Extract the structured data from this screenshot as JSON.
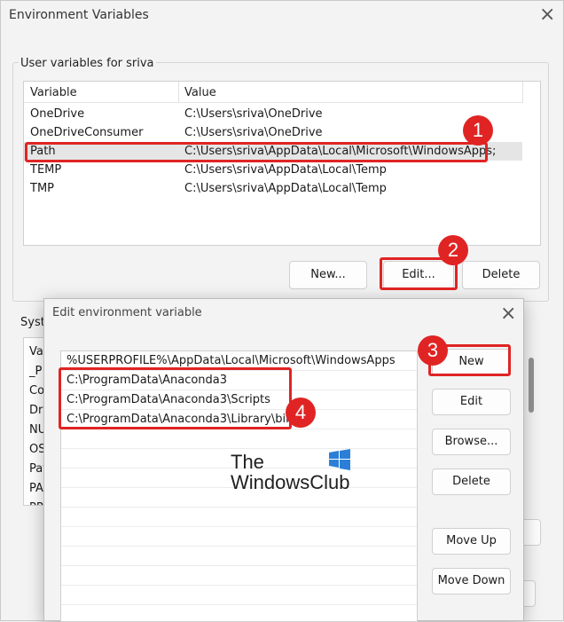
{
  "window": {
    "title": "Environment Variables",
    "close_glyph": "×",
    "user_group_label": "User variables for sriva",
    "columns": {
      "variable": "Variable",
      "value": "Value"
    },
    "user_vars": [
      {
        "name": "OneDrive",
        "value": "C:\\Users\\sriva\\OneDrive",
        "selected": false
      },
      {
        "name": "OneDriveConsumer",
        "value": "C:\\Users\\sriva\\OneDrive",
        "selected": false
      },
      {
        "name": "Path",
        "value": "C:\\Users\\sriva\\AppData\\Local\\Microsoft\\WindowsApps;",
        "selected": true
      },
      {
        "name": "TEMP",
        "value": "C:\\Users\\sriva\\AppData\\Local\\Temp",
        "selected": false
      },
      {
        "name": "TMP",
        "value": "C:\\Users\\sriva\\AppData\\Local\\Temp",
        "selected": false
      }
    ],
    "buttons": {
      "new": "New...",
      "edit": "Edit...",
      "delete": "Delete"
    },
    "system_group_label": "Syste",
    "system_items": [
      "Va",
      "_P",
      "Co",
      "Dri",
      "NU",
      "OS",
      "Pat",
      "PA",
      "PR"
    ]
  },
  "dialog": {
    "title": "Edit environment variable",
    "close_glyph": "×",
    "entries": [
      "%USERPROFILE%\\AppData\\Local\\Microsoft\\WindowsApps",
      "C:\\ProgramData\\Anaconda3",
      "C:\\ProgramData\\Anaconda3\\Scripts",
      "C:\\ProgramData\\Anaconda3\\Library\\bin"
    ],
    "buttons": {
      "new": "New",
      "edit": "Edit",
      "browse": "Browse...",
      "delete": "Delete",
      "move_up": "Move Up",
      "move_down": "Move Down"
    }
  },
  "annotations": {
    "badge_1": "1",
    "badge_2": "2",
    "badge_3": "3",
    "badge_4": "4",
    "color": "#e02424"
  },
  "watermark": {
    "line1": "The",
    "line2": "WindowsClub"
  }
}
